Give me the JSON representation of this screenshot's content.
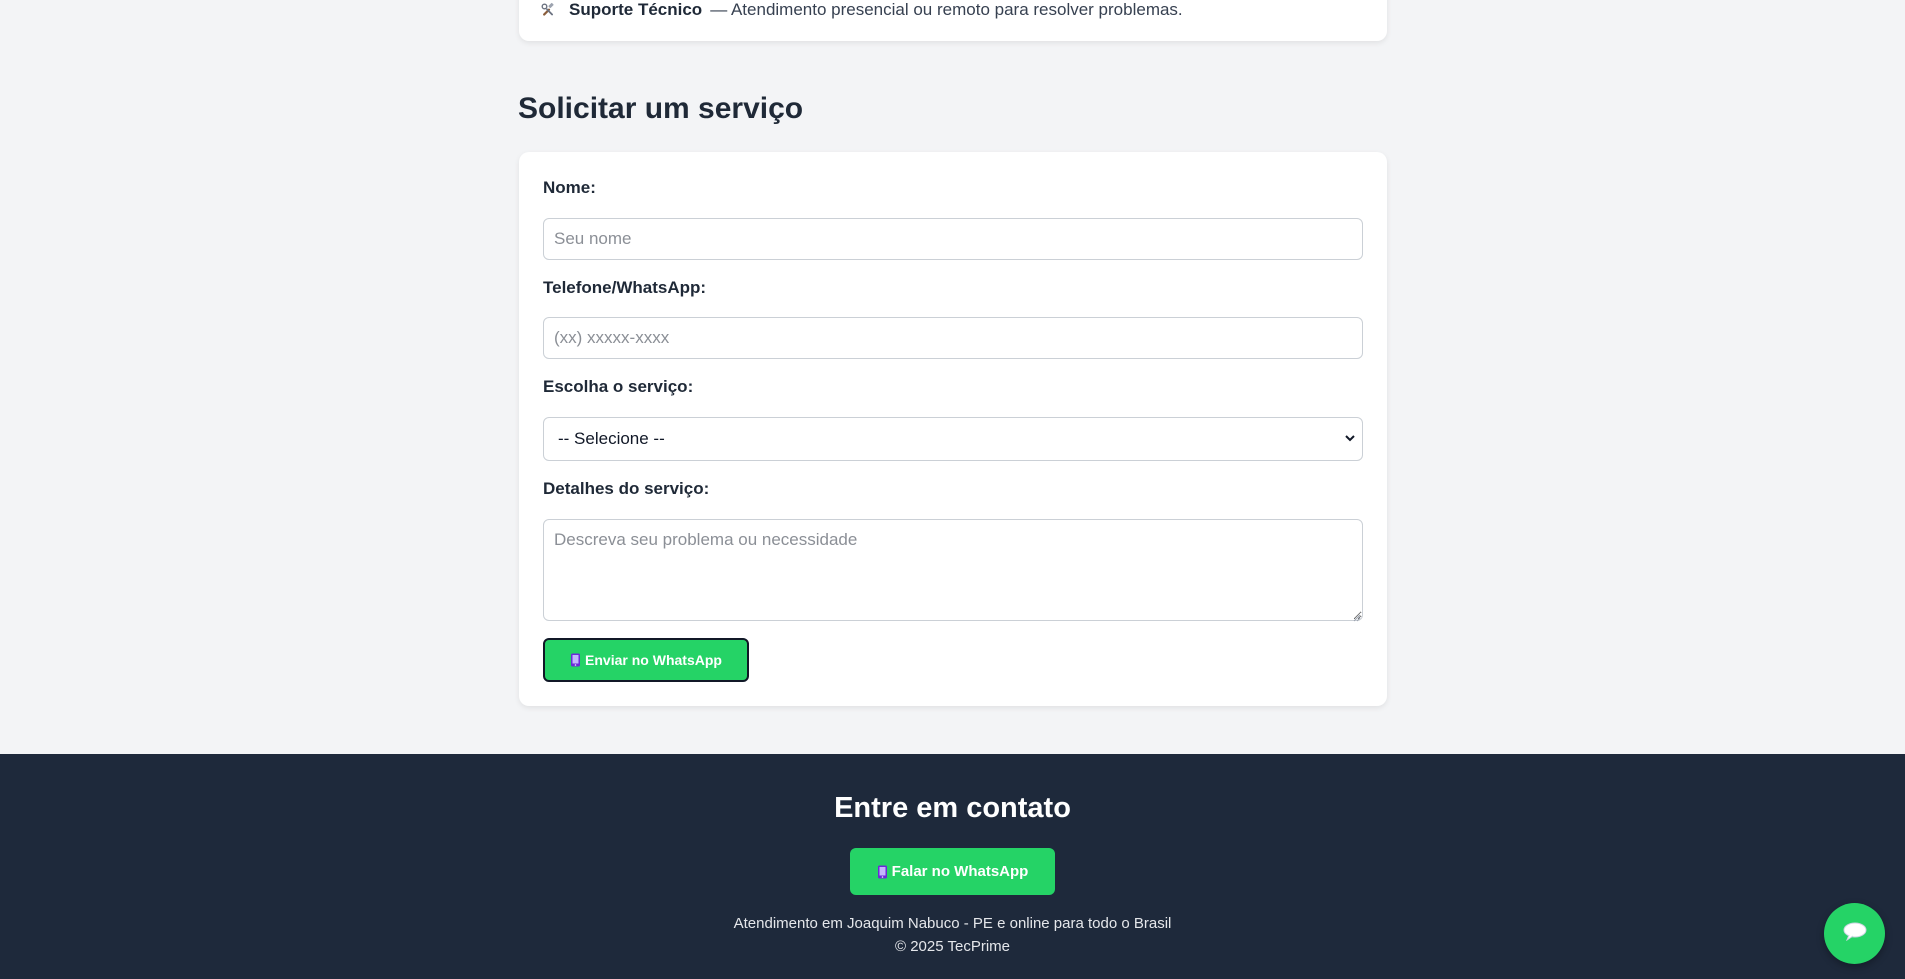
{
  "services": {
    "last_item": {
      "icon": "hammer-wrench-icon",
      "name": "Suporte Técnico",
      "description": "— Atendimento presencial ou remoto para resolver problemas."
    }
  },
  "request_section": {
    "title": "Solicitar um serviço"
  },
  "form": {
    "name_label": "Nome:",
    "name_placeholder": "Seu nome",
    "phone_label": "Telefone/WhatsApp:",
    "phone_placeholder": "(xx) xxxxx-xxxx",
    "service_label": "Escolha o serviço:",
    "service_selected": "-- Selecione --",
    "details_label": "Detalhes do serviço:",
    "details_placeholder": "Descreva seu problema ou necessidade",
    "submit_icon": "mobile-phone-icon",
    "submit_label": "Enviar no WhatsApp"
  },
  "footer": {
    "title": "Entre em contato",
    "whatsapp_icon": "mobile-phone-icon",
    "whatsapp_label": "Falar no WhatsApp",
    "location_text": "Atendimento em Joaquim Nabuco - PE e online para todo o Brasil",
    "copyright": "© 2025 TecPrime"
  },
  "floating_chat": {
    "icon": "speech-bubble-icon"
  },
  "colors": {
    "page_background": "#f3f4f6",
    "card_background": "#ffffff",
    "text_primary": "#1f2937",
    "whatsapp_green": "#25d366",
    "footer_background": "#1e293b"
  }
}
